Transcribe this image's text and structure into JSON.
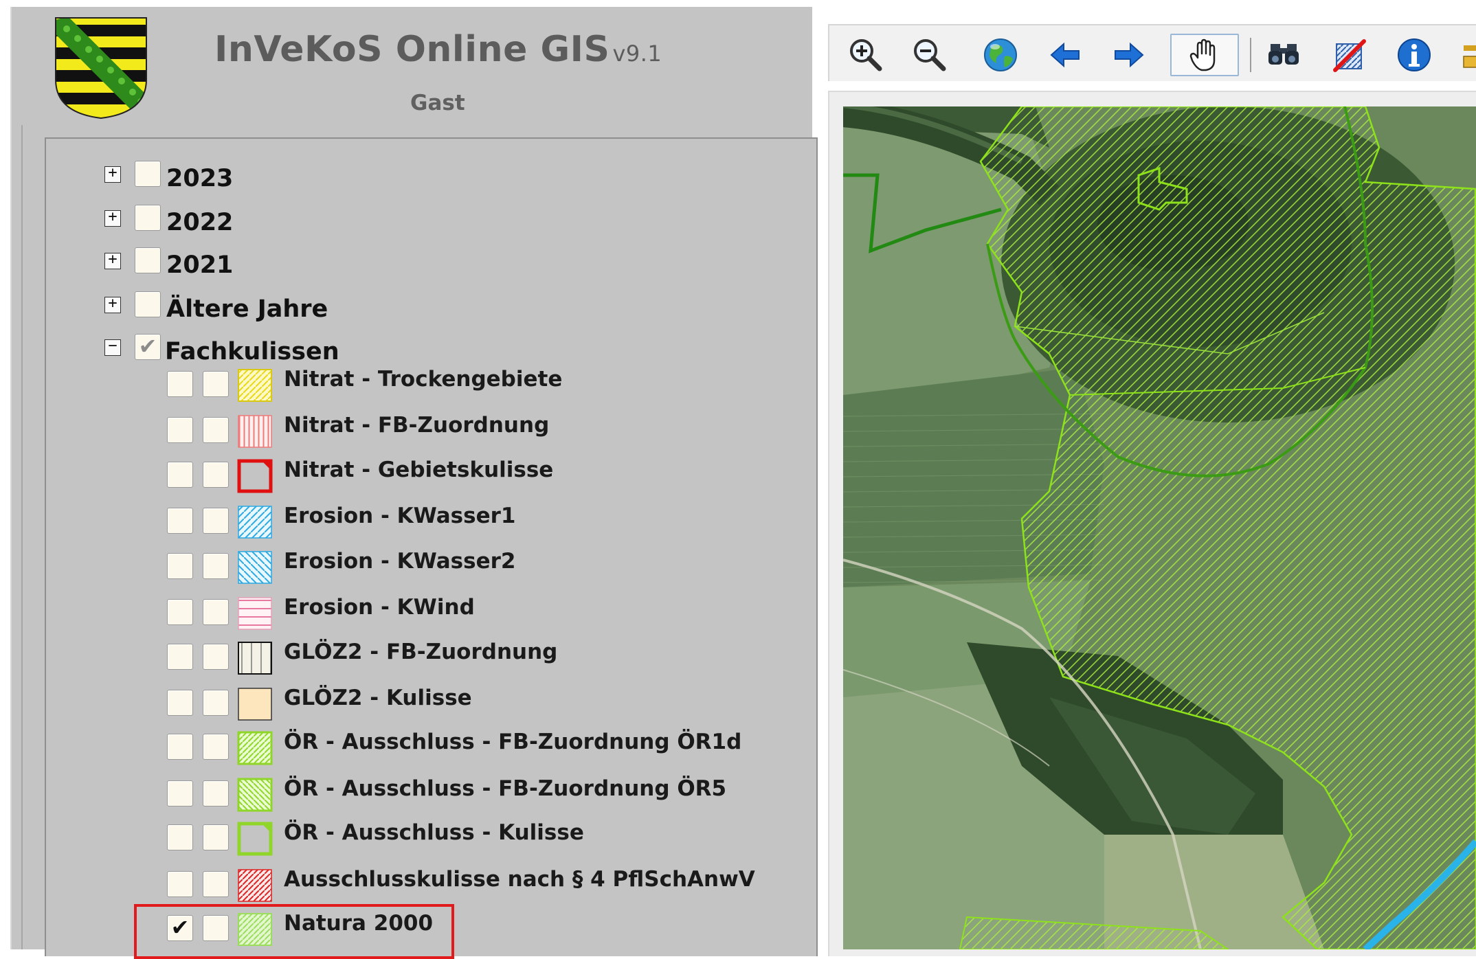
{
  "app": {
    "title": "InVeKoS Online GIS",
    "version": "v9.1",
    "user": "Gast"
  },
  "logo": {
    "icon": "saxony-coat-of-arms-icon",
    "colors": {
      "yellow": "#f2ea1a",
      "black": "#111111",
      "green": "#2f8a1c"
    }
  },
  "tree": {
    "years": [
      {
        "label": "2023",
        "expander": "+",
        "checked": false
      },
      {
        "label": "2022",
        "expander": "+",
        "checked": false
      },
      {
        "label": "2021",
        "expander": "+",
        "checked": false
      },
      {
        "label": "Ältere Jahre",
        "expander": "+",
        "checked": false
      }
    ],
    "fachkulissen": {
      "label": "Fachkulissen",
      "expander": "−",
      "checked": "partial",
      "check_glyph": "✔",
      "layers": [
        {
          "label": "Nitrat - Trockengebiete",
          "visible": false,
          "selectable": false,
          "symbol": "hatch-yellow"
        },
        {
          "label": "Nitrat - FB-Zuordnung",
          "visible": false,
          "selectable": false,
          "symbol": "vertical-red"
        },
        {
          "label": "Nitrat - Gebietskulisse",
          "visible": false,
          "selectable": false,
          "symbol": "outline-red"
        },
        {
          "label": "Erosion - KWasser1",
          "visible": false,
          "selectable": false,
          "symbol": "hatch-cyan"
        },
        {
          "label": "Erosion - KWasser2",
          "visible": false,
          "selectable": false,
          "symbol": "backhatch-cyan"
        },
        {
          "label": "Erosion - KWind",
          "visible": false,
          "selectable": false,
          "symbol": "horizontal-pink"
        },
        {
          "label": "GLÖZ2 - FB-Zuordnung",
          "visible": false,
          "selectable": false,
          "symbol": "vertical-black"
        },
        {
          "label": "GLÖZ2 - Kulisse",
          "visible": false,
          "selectable": false,
          "symbol": "fill-beige"
        },
        {
          "label": "ÖR - Ausschluss - FB-Zuordnung ÖR1d",
          "visible": false,
          "selectable": false,
          "symbol": "hatch-green"
        },
        {
          "label": "ÖR - Ausschluss - FB-Zuordnung ÖR5",
          "visible": false,
          "selectable": false,
          "symbol": "backhatch-green"
        },
        {
          "label": "ÖR - Ausschluss - Kulisse",
          "visible": false,
          "selectable": false,
          "symbol": "outline-green"
        },
        {
          "label": "Ausschlusskulisse nach § 4 PflSchAnwV",
          "visible": false,
          "selectable": false,
          "symbol": "hatch-red"
        },
        {
          "label": "Natura 2000",
          "visible": true,
          "selectable": false,
          "symbol": "hatch-lightgreen",
          "check_glyph": "✔",
          "highlighted": true
        }
      ]
    }
  },
  "toolbar": {
    "tools": [
      {
        "name": "zoom-in",
        "icon": "zoom-in-icon"
      },
      {
        "name": "zoom-out",
        "icon": "zoom-out-icon"
      },
      {
        "name": "full-extent",
        "icon": "globe-icon"
      },
      {
        "name": "previous-extent",
        "icon": "arrow-left-icon"
      },
      {
        "name": "next-extent",
        "icon": "arrow-right-icon"
      },
      {
        "name": "pan",
        "icon": "hand-icon",
        "active": true
      },
      {
        "name": "search",
        "icon": "binoculars-icon"
      },
      {
        "name": "clear-selection",
        "icon": "clear-selection-icon"
      },
      {
        "name": "info",
        "icon": "info-icon"
      },
      {
        "name": "more",
        "icon": "more-icon"
      }
    ]
  },
  "map": {
    "content": "aerial-imagery-with-natura2000-overlay",
    "colors": {
      "overlay_outline": "#8ee21a",
      "forest_border": "#3c9b14",
      "river": "#2ab3e8"
    }
  }
}
